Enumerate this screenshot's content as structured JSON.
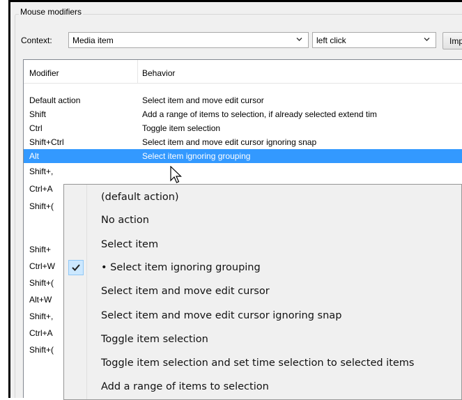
{
  "group_title": "Mouse modifiers",
  "context_label": "Context:",
  "context_value": "Media item",
  "action_value": "left click",
  "import_button_label": "Imp",
  "columns": {
    "modifier": "Modifier",
    "behavior": "Behavior"
  },
  "rows": [
    {
      "modifier": "Default action",
      "behavior": "Select item and move edit cursor"
    },
    {
      "modifier": "Shift",
      "behavior": "Add a range of items to selection, if already selected extend tim"
    },
    {
      "modifier": "Ctrl",
      "behavior": "Toggle item selection"
    },
    {
      "modifier": "Shift+Ctrl",
      "behavior": "Select item and move edit cursor ignoring snap"
    },
    {
      "modifier": "Alt",
      "behavior": "Select item ignoring grouping"
    }
  ],
  "partial_modifiers": [
    "Shift+,",
    "Ctrl+A",
    "Shift+(",
    "Shift+",
    "Ctrl+W",
    "Shift+(",
    "Alt+W",
    "Shift+,",
    "Ctrl+A",
    "Shift+("
  ],
  "menu_items": [
    "(default action)",
    "No action",
    "Select item",
    "• Select item ignoring grouping",
    "Select item and move edit cursor",
    "Select item and move edit cursor ignoring snap",
    "Toggle item selection",
    "Toggle item selection and set time selection to selected items",
    "Add a range of items to selection"
  ],
  "icons": {
    "checked": "checkmark-icon",
    "dropdown": "chevron-down-icon",
    "pointer": "mouse-pointer-icon"
  },
  "colors": {
    "selection": "#3399ff",
    "menu_check_bg": "#cce8ff"
  }
}
